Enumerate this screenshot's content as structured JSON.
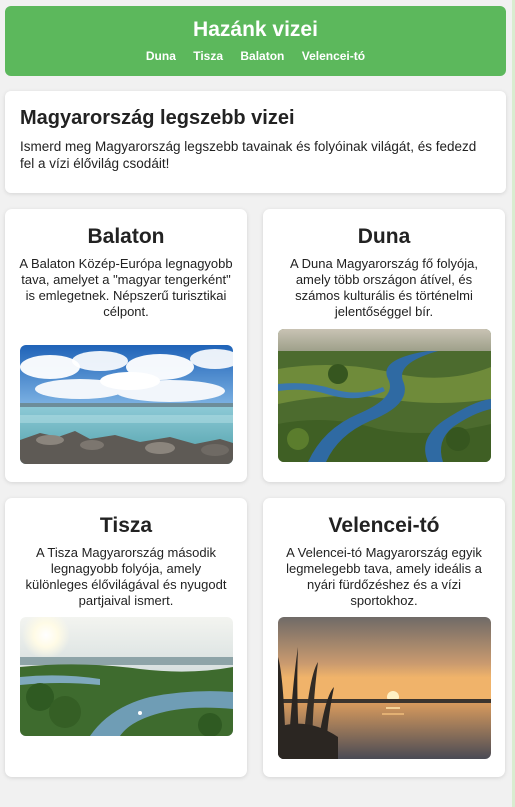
{
  "header": {
    "title": "Hazánk vizei",
    "nav": [
      "Duna",
      "Tisza",
      "Balaton",
      "Velencei-tó"
    ]
  },
  "intro": {
    "title": "Magyarország legszebb vizei",
    "text": "Ismerd meg Magyarország legszebb tavainak és folyóinak világát, és fedezd fel a vízi élővilág csodáit!"
  },
  "cards": [
    {
      "title": "Balaton",
      "text": "A Balaton Közép-Európa legnagyobb tava, amelyet a \"magyar tengerként\" is emlegetnek. Népszerű turisztikai célpont.",
      "image": "balaton-lake-photo"
    },
    {
      "title": "Duna",
      "text": "A Duna Magyarország fő folyója, amely több országon átível, és számos kulturális és történelmi jelentőséggel bír.",
      "image": "danube-aerial-photo"
    },
    {
      "title": "Tisza",
      "text": "A Tisza Magyarország második legnagyobb folyója, amely különleges élővilágával és nyugodt partjaival ismert.",
      "image": "tisza-river-photo"
    },
    {
      "title": "Velencei-tó",
      "text": "A Velencei-tó Magyarország egyik legmelegebb tava, amely ideális a nyári fürdőzéshez és a vízi sportokhoz.",
      "image": "velence-sunset-photo"
    }
  ],
  "colors": {
    "header_bg": "#5cb85c",
    "page_bg": "#f1f1f1",
    "card_bg": "#ffffff"
  }
}
